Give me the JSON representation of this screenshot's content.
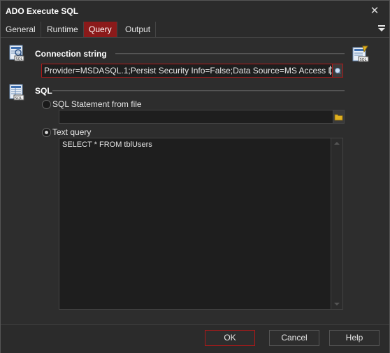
{
  "window": {
    "title": "ADO Execute SQL",
    "close_glyph": "✕"
  },
  "tabs": [
    {
      "label": "General"
    },
    {
      "label": "Runtime"
    },
    {
      "label": "Query",
      "active": true
    },
    {
      "label": "Output"
    }
  ],
  "connection": {
    "label": "Connection string",
    "value": "Provider=MSDASQL.1;Persist Security Info=False;Data Source=MS Access Database",
    "icon": "sql-connection-icon",
    "builder_icon": "sql-builder-icon"
  },
  "sql": {
    "label": "SQL",
    "icon": "sql-table-icon",
    "option_file_label": "SQL Statement from file",
    "option_text_label": "Text query",
    "file_path": "",
    "selected_option": "Text query",
    "query_text": "SELECT * FROM tblUsers"
  },
  "buttons": {
    "ok": "OK",
    "cancel": "Cancel",
    "help": "Help"
  },
  "colors": {
    "accent": "#8b1a1a",
    "focus_border": "#b01818",
    "background": "#2d2d2d"
  }
}
